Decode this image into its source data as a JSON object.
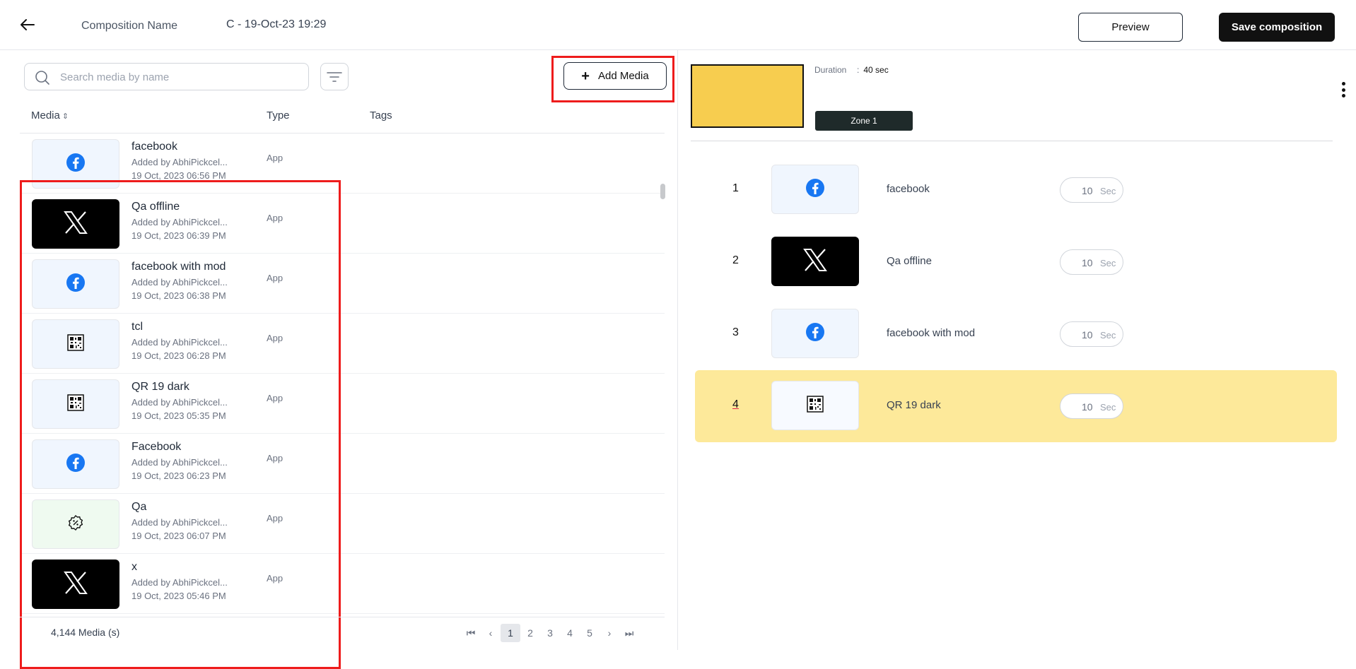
{
  "header": {
    "composition_label": "Composition Name",
    "composition_name": "C - 19-Oct-23 19:29",
    "preview_label": "Preview",
    "save_label": "Save composition"
  },
  "library": {
    "search_placeholder": "Search media by name",
    "add_media_label": "Add Media",
    "columns": {
      "media": "Media",
      "type": "Type",
      "tags": "Tags"
    },
    "rows": [
      {
        "name": "facebook",
        "added_by": "Added by AbhiPickcel...",
        "date": "19 Oct, 2023 06:56 PM",
        "type": "App",
        "icon": "facebook-icon"
      },
      {
        "name": "Qa offline",
        "added_by": "Added by AbhiPickcel...",
        "date": "19 Oct, 2023 06:39 PM",
        "type": "App",
        "icon": "x-logo-icon"
      },
      {
        "name": "facebook with mod",
        "added_by": "Added by AbhiPickcel...",
        "date": "19 Oct, 2023 06:38 PM",
        "type": "App",
        "icon": "facebook-icon"
      },
      {
        "name": "tcl",
        "added_by": "Added by AbhiPickcel...",
        "date": "19 Oct, 2023 06:28 PM",
        "type": "App",
        "icon": "qr-code-icon"
      },
      {
        "name": "QR 19 dark",
        "added_by": "Added by AbhiPickcel...",
        "date": "19 Oct, 2023 05:35 PM",
        "type": "App",
        "icon": "qr-code-icon"
      },
      {
        "name": "Facebook",
        "added_by": "Added by AbhiPickcel...",
        "date": "19 Oct, 2023 06:23 PM",
        "type": "App",
        "icon": "facebook-icon"
      },
      {
        "name": "Qa",
        "added_by": "Added by AbhiPickcel...",
        "date": "19 Oct, 2023 06:07 PM",
        "type": "App",
        "icon": "discount-badge-icon"
      },
      {
        "name": "x",
        "added_by": "Added by AbhiPickcel...",
        "date": "19 Oct, 2023 05:46 PM",
        "type": "App",
        "icon": "x-logo-icon"
      }
    ],
    "count_text": "4,144 Media (s)",
    "pages": [
      "1",
      "2",
      "3",
      "4",
      "5"
    ],
    "current_page": "1"
  },
  "zone": {
    "duration_label": "Duration",
    "duration_sep": ":",
    "duration_value": "40 sec",
    "zone_label": "Zone 1",
    "preview_color": "#f7cd4f",
    "items": [
      {
        "num": "1",
        "name": "facebook",
        "duration": "10",
        "unit": "Sec",
        "icon": "facebook-icon"
      },
      {
        "num": "2",
        "name": "Qa offline",
        "duration": "10",
        "unit": "Sec",
        "icon": "x-logo-icon"
      },
      {
        "num": "3",
        "name": "facebook with mod",
        "duration": "10",
        "unit": "Sec",
        "icon": "facebook-icon"
      },
      {
        "num": "4",
        "name": "QR 19 dark",
        "duration": "10",
        "unit": "Sec",
        "icon": "qr-code-icon"
      }
    ]
  },
  "colors": {
    "highlight_red": "#ee1c1c",
    "selected_row": "#fde99a",
    "facebook_blue": "#1877f2"
  }
}
